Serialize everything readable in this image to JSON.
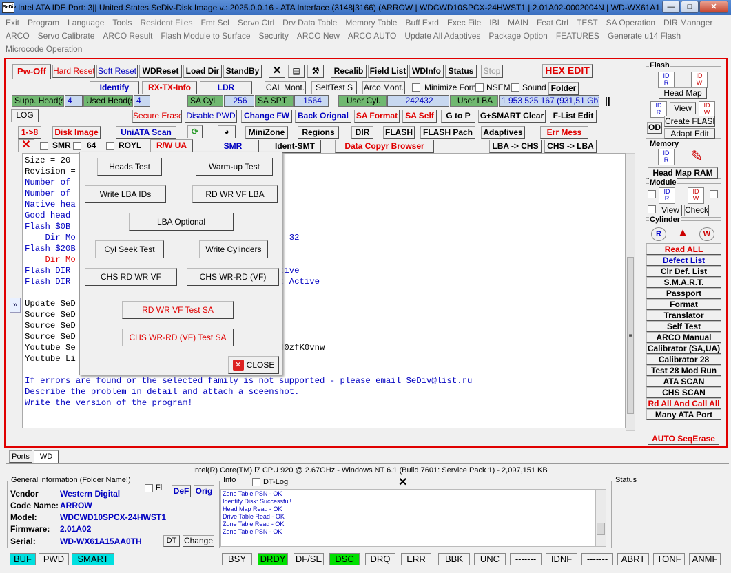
{
  "window": {
    "title": "Intel ATA IDE  Port: 3|| United States  SeDiv-Disk Image v.: 2025.0.0.16 - ATA Interface (3148|3166)  (ARROW | WDCWD10SPCX-24HWST1 | 2.01A02-0002004N | WD-WX61A1...",
    "icon": "SeDiv"
  },
  "menu": [
    "Exit",
    "Program",
    "Language",
    "Tools",
    "Resident Files",
    "Fmt Sel",
    "Servo Ctrl",
    "Drv Data Table",
    "Memory Table",
    "Buff Extd",
    "Exec File",
    "IBI",
    "MAIN",
    "Feat Ctrl",
    "TEST",
    "SA Operation",
    "DIR Manager",
    "ARCO",
    "Servo Calibrate",
    "ARCO Result",
    "Flash Module to Surface",
    "Security",
    "ARCO New",
    "ARCO AUTO",
    "Update All Adaptives",
    "Package Option",
    "FEATURES",
    "Generate u14 Flash",
    "Microcode Operation"
  ],
  "toolbar1": {
    "pwoff": "Pw-Off",
    "hard": "Hard Reset",
    "soft": "Soft Reset",
    "wdreset": "WDReset",
    "loaddir": "Load Dir",
    "standby": "StandBy",
    "recalib": "Recalib",
    "fieldlist": "Field List",
    "wdinfo": "WDInfo",
    "status": "Status",
    "stop": "Stop",
    "hexedit": "HEX EDIT"
  },
  "toolbar2": {
    "identify": "Identify",
    "rxtx": "RX-TX-Info",
    "ldr": "LDR",
    "calmont": "CAL Mont.",
    "selftest": "SelfTest S",
    "arcomont": "Arco Mont.",
    "minimize": "Minimize Form",
    "nsem": "NSEM",
    "sound": "Sound",
    "folder": "Folder"
  },
  "fields": {
    "supp_heads_label": "Supp. Head(s)",
    "supp_heads": "4",
    "used_heads_label": "Used Head(s)",
    "used_heads": "4",
    "sacyl_label": "SA Cyl",
    "sacyl": "256",
    "saspt_label": "SA SPT",
    "saspt": "1564",
    "usercyl_label": "User Cyl.",
    "usercyl": "242432",
    "userlba_label": "User LBA",
    "userlba": "1 953 525 167  (931,51 Gb)"
  },
  "toolbar3": {
    "log": "LOG",
    "secure": "Secure Erase",
    "dispwd": "Disable PWD",
    "changefw": "Change FW",
    "backorig": "Back Orignal",
    "saformat": "SA Format",
    "saself": "SA Self",
    "gtop": "G to P",
    "gsmart": "G+SMART Clear",
    "flist": "F-List Edit"
  },
  "toolbar4": {
    "r18": "1->8",
    "diskimage": "Disk Image",
    "uniata": "UniATA Scan",
    "minizone": "MiniZone",
    "regions": "Regions",
    "dir": "DIR",
    "flash": "FLASH",
    "flashpach": "FLASH Pach",
    "adaptives": "Adaptives",
    "errmess": "Err Mess"
  },
  "toolbar5": {
    "smr": "SMR",
    "c64": "64",
    "royl": "ROYL",
    "rwua": "R/W UA",
    "smr2": "SMR",
    "identsmt": "Ident-SMT",
    "datacopy": "Data Copyr Browser",
    "lbachs": "LBA -> CHS",
    "chslba": "CHS -> LBA"
  },
  "console": [
    {
      "t": "Size = 20",
      "c": "#000"
    },
    {
      "t": "Revision = ",
      "c": "#000"
    },
    {
      "t": "Number of ",
      "c": "#0000c0"
    },
    {
      "t": "Number of ",
      "c": "#0000c0"
    },
    {
      "t": "Native hea",
      "c": "#0000c0"
    },
    {
      "t": "Good head ",
      "c": "#0000c0"
    },
    {
      "t": "Flash $0B                     ................. OK!",
      "c": "#0000c0"
    },
    {
      "t": "    Dir Mo                                  FSize = 32",
      "c": "#0000c0"
    },
    {
      "t": "Flash $20B                    ................. OK!",
      "c": "#0000c0"
    },
    {
      "t": "    Dir Mo                   2    FSize = 32",
      "c": "#e00000"
    },
    {
      "t": "Flash DIR                     ................. Active",
      "c": "#0000c0"
    },
    {
      "t": "Flash DIR                     ................. Not Active",
      "c": "#0000c0"
    },
    {
      "t": "",
      "c": "#000"
    },
    {
      "t": "Update SeD                    /xgnk/m851bWtz1",
      "c": "#000"
    },
    {
      "t": "Source SeD                    /7yLd/bbpXuTZ2n",
      "c": "#000"
    },
    {
      "t": "Source SeD                    /RW5F/ipfAx6FUh",
      "c": "#000"
    },
    {
      "t": "Source SeD                    /2BFX/5QbikXFKy",
      "c": "#000"
    },
    {
      "t": "Youtube Se                    nnel/UCaDZahGtMm8pO240zfK0vnw",
      "c": "#000"
    },
    {
      "t": "Youtube Li                    storesedivagency9099",
      "c": "#000"
    },
    {
      "t": "",
      "c": "#000"
    },
    {
      "t": "If errors are found or the selected family is not supported - please email SeDiv@list.ru",
      "c": "#0000c0"
    },
    {
      "t": "Describe the problem in detail and attach a sceenshot.",
      "c": "#0000c0"
    },
    {
      "t": "Write the version of the program!",
      "c": "#0000c0"
    }
  ],
  "popup": {
    "heads": "Heads Test",
    "warmup": "Warm-up Test",
    "writelba": "Write LBA IDs",
    "rdwrvflba": "RD WR VF LBA",
    "lbaopt": "LBA Optional",
    "cylseek": "Cyl Seek Test",
    "writecyl": "Write Cylinders",
    "chsrdwrvf": "CHS RD WR VF",
    "chswrrdvf": "CHS WR-RD (VF)",
    "rdwrvfsa": "RD WR VF Test SA",
    "chswrrdsa": "CHS WR-RD (VF) Test SA",
    "close": "CLOSE"
  },
  "right": {
    "flash": "Flash",
    "headmap": "Head Map",
    "view": "View",
    "od": "OD",
    "createflash": "Create FLASH",
    "adaptedit": "Adapt Edit",
    "memory": "Memory",
    "headmapram": "Head Map RAM",
    "module": "Module",
    "view2": "View",
    "check": "Check",
    "cylinder": "Cylinder",
    "list": [
      {
        "t": "Read ALL",
        "c": "#e00000"
      },
      {
        "t": "Defect List",
        "c": "#0000c0"
      },
      {
        "t": "Clr Def. List",
        "c": "#000"
      },
      {
        "t": "S.M.A.R.T.",
        "c": "#000"
      },
      {
        "t": "Passport",
        "c": "#000"
      },
      {
        "t": "Format",
        "c": "#000"
      },
      {
        "t": "Translator",
        "c": "#000"
      },
      {
        "t": "Self Test",
        "c": "#000"
      },
      {
        "t": "ARCO Manual",
        "c": "#000"
      },
      {
        "t": "Calibrator (SA,UA)",
        "c": "#000"
      },
      {
        "t": "Calibrator 28",
        "c": "#000"
      },
      {
        "t": "Test 28 Mod Run",
        "c": "#000"
      },
      {
        "t": "ATA SCAN",
        "c": "#000"
      },
      {
        "t": "CHS SCAN",
        "c": "#000"
      },
      {
        "t": "Rd All And Call All",
        "c": "#e00000"
      },
      {
        "t": "Many ATA Port",
        "c": "#000"
      }
    ],
    "autoseq": "AUTO SeqErase"
  },
  "tabs": {
    "ports": "Ports",
    "wd": "WD"
  },
  "cpu": "Intel(R) Core(TM) i7 CPU 920  @ 2.67GHz - Windows NT 6.1 (Build 7601: Service Pack 1) -  2,097,151 KB",
  "general": {
    "title": "General information (Folder Name!)",
    "fl": "Fl",
    "def": "DeF",
    "orig": "Orig",
    "vendor_l": "Vendor",
    "vendor": "Western Digital",
    "code_l": "Code Name:",
    "code": "ARROW",
    "model_l": "Model:",
    "model": "WDCWD10SPCX-24HWST1",
    "fw_l": "Firmware:",
    "fw": "2.01A02",
    "serial_l": "Serial:",
    "serial": "WD-WX61A15AA0TH",
    "dt": "DT",
    "change": "Change"
  },
  "info": {
    "title": "Info",
    "dtlog": "DT-Log",
    "lines": [
      "Zone Table PSN - OK",
      "Identify Disk: Successful!",
      "Head Map Read - OK",
      "Drive Table Read - OK",
      "Zone Table Read - OK",
      "Zone Table PSN - OK"
    ]
  },
  "status": {
    "title": "Status"
  },
  "bottom": {
    "left": [
      {
        "t": "BUF",
        "bg": "#00e0e0"
      },
      {
        "t": "PWD",
        "bg": "#f0f0f0"
      },
      {
        "t": "SMART",
        "bg": "#00e0e0"
      }
    ],
    "regs": [
      {
        "t": "BSY",
        "bg": "#f0f0f0"
      },
      {
        "t": "DRDY",
        "bg": "#00e000"
      },
      {
        "t": "DF/SE",
        "bg": "#f0f0f0"
      },
      {
        "t": "DSC",
        "bg": "#00e000"
      },
      {
        "t": "DRQ",
        "bg": "#f0f0f0"
      },
      {
        "t": "ERR",
        "bg": "#f0f0f0"
      }
    ],
    "errs": [
      {
        "t": "BBK"
      },
      {
        "t": "UNC"
      },
      {
        "t": "-------"
      },
      {
        "t": "IDNF"
      },
      {
        "t": "-------"
      },
      {
        "t": "ABRT"
      },
      {
        "t": "TONF"
      },
      {
        "t": "ANMF"
      }
    ]
  }
}
